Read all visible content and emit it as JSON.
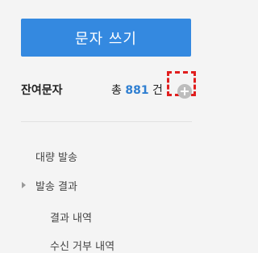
{
  "compose_button": {
    "label": "문자 쓰기"
  },
  "remaining": {
    "label": "잔여문자",
    "total_prefix": "총",
    "count": "881",
    "unit": "건"
  },
  "menu": {
    "items": [
      {
        "label": "대량 발송"
      },
      {
        "label": "발송 결과"
      },
      {
        "label": "결과 내역"
      },
      {
        "label": "수신 거부 내역"
      }
    ]
  },
  "colors": {
    "accent": "#3489e0",
    "count": "#2f7fd1",
    "highlight": "#e01e1e"
  }
}
